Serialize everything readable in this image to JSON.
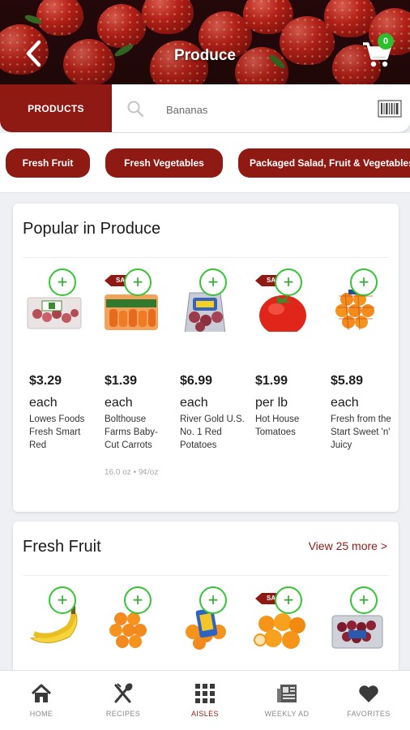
{
  "header": {
    "title": "Produce",
    "cart_count": "0"
  },
  "search": {
    "tab_label": "PRODUCTS",
    "query": "Bananas"
  },
  "categories": [
    "Fresh Fruit",
    "Fresh Vegetables",
    "Packaged Salad, Fruit & Vegetables"
  ],
  "popular": {
    "title": "Popular in Produce",
    "items": [
      {
        "price": "$3.29",
        "unit": "each",
        "name": "Lowes Foods Fresh Smart Red",
        "size": "",
        "sale": false,
        "image": "red-potatoes-bag"
      },
      {
        "price": "$1.39",
        "unit": "each",
        "name": "Bolthouse Farms Baby-Cut Carrots",
        "size": "16.0 oz • 9¢/oz",
        "sale": true,
        "image": "baby-carrots-bag"
      },
      {
        "price": "$6.99",
        "unit": "each",
        "name": "River Gold U.S. No. 1 Red Potatoes",
        "size": "",
        "sale": false,
        "image": "potatoes-bag"
      },
      {
        "price": "$1.99",
        "unit": "per lb",
        "name": "Hot House Tomatoes",
        "size": "",
        "sale": true,
        "image": "tomato"
      },
      {
        "price": "$5.89",
        "unit": "each",
        "name": "Fresh from the Start Sweet 'n' Juicy",
        "size": "",
        "sale": false,
        "image": "oranges-bag"
      }
    ]
  },
  "fresh_fruit": {
    "title": "Fresh Fruit",
    "view_more": "View 25 more >",
    "items": [
      {
        "sale": false,
        "image": "bananas"
      },
      {
        "sale": false,
        "image": "oranges-bag"
      },
      {
        "sale": false,
        "image": "clementines-bag"
      },
      {
        "sale": true,
        "image": "oranges"
      },
      {
        "sale": false,
        "image": "grapes-container"
      }
    ]
  },
  "sale_label": "SALE",
  "nav": [
    {
      "label": "HOME",
      "icon": "home-icon",
      "active": false
    },
    {
      "label": "RECIPES",
      "icon": "utensils-icon",
      "active": false
    },
    {
      "label": "AISLES",
      "icon": "grid-icon",
      "active": true
    },
    {
      "label": "WEEKLY AD",
      "icon": "newspaper-icon",
      "active": false
    },
    {
      "label": "FAVORITES",
      "icon": "heart-icon",
      "active": false
    }
  ],
  "colors": {
    "brand": "#8f1a14",
    "add": "#33c533",
    "badge": "#2cbf2c"
  }
}
